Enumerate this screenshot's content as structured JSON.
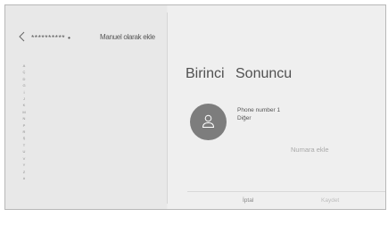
{
  "header": {
    "back_icon": "chevron-left-icon",
    "title": "**********",
    "separator": "•",
    "subtitle": "Manuel olarak ekle"
  },
  "index_letters": [
    "A",
    "Ç",
    "D",
    "G",
    "İ",
    "J",
    "K",
    "M",
    "N",
    "P",
    "R",
    "Ş",
    "T",
    "U",
    "V",
    "Y",
    "Z",
    "#"
  ],
  "contact": {
    "first_name": "Birinci",
    "last_name": "Sonuncu",
    "avatar_icon": "person-icon",
    "phone_label": "Phone number 1",
    "phone_type": "Diğer",
    "add_number": "Numara ekle"
  },
  "footer": {
    "cancel_label": "İptal",
    "save_label": "Kaydet"
  },
  "colors": {
    "background": "#ececec",
    "avatar": "#7d7d7d",
    "text": "#505050",
    "disabled_text": "#bdbdbd"
  }
}
